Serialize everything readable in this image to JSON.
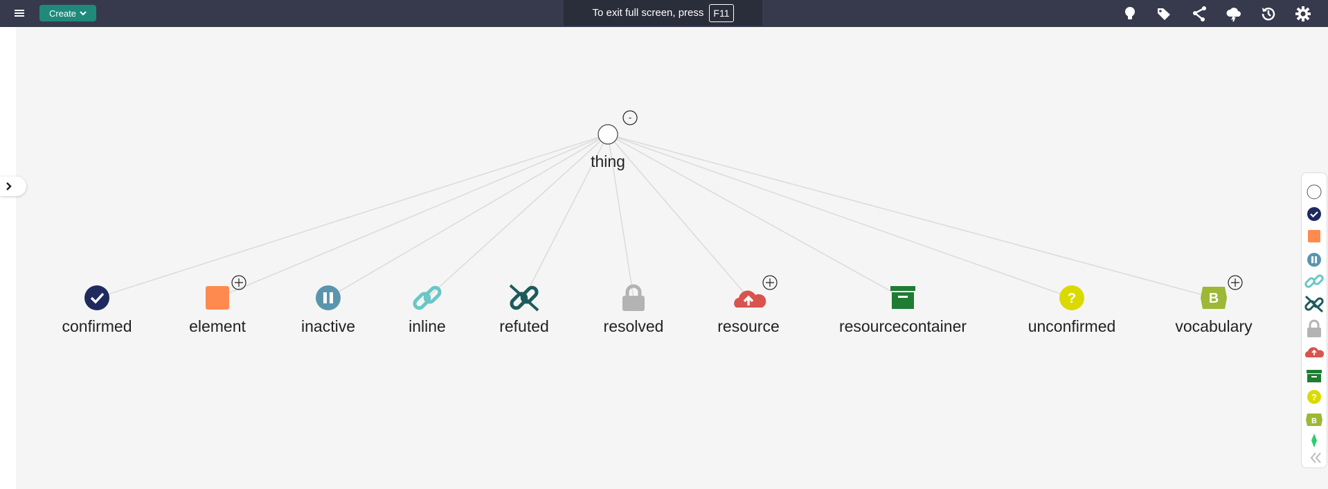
{
  "toolbar": {
    "create_label": "Create",
    "fullscreen_notice": "To exit full screen, press",
    "fullscreen_key": "F11",
    "icons": [
      "lightbulb-icon",
      "tags-icon",
      "share-nodes-icon",
      "cloud-lightning-icon",
      "history-icon",
      "gear-icon"
    ]
  },
  "graph": {
    "root": {
      "label": "thing",
      "toggle": "-"
    },
    "children": [
      {
        "label": "confirmed",
        "icon": "check-circle-icon",
        "color": "#1f2a5e",
        "expandable": false
      },
      {
        "label": "element",
        "icon": "square-icon",
        "color": "#ff8a50",
        "expandable": true
      },
      {
        "label": "inactive",
        "icon": "pause-circle-icon",
        "color": "#5a95ad",
        "expandable": false
      },
      {
        "label": "inline",
        "icon": "link-icon",
        "color": "#6bc6c6",
        "expandable": false
      },
      {
        "label": "refuted",
        "icon": "unlink-icon",
        "color": "#1d5b5b",
        "expandable": false
      },
      {
        "label": "resolved",
        "icon": "lock-icon",
        "color": "#b3b3b3",
        "expandable": false
      },
      {
        "label": "resource",
        "icon": "cloud-upload-icon",
        "color": "#d9534f",
        "expandable": true
      },
      {
        "label": "resourcecontainer",
        "icon": "archive-icon",
        "color": "#1e7c33",
        "expandable": false
      },
      {
        "label": "unconfirmed",
        "icon": "question-circle-icon",
        "color": "#dada00",
        "expandable": false
      },
      {
        "label": "vocabulary",
        "icon": "brackets-b-icon",
        "color": "#9db836",
        "expandable": true
      }
    ]
  },
  "legend": {
    "items": [
      "circle-outline-icon",
      "check-circle-icon",
      "square-icon",
      "pause-circle-icon",
      "link-icon",
      "unlink-icon",
      "lock-icon",
      "cloud-upload-icon",
      "archive-icon",
      "question-circle-icon",
      "brackets-b-icon",
      "diamond-icon"
    ]
  }
}
